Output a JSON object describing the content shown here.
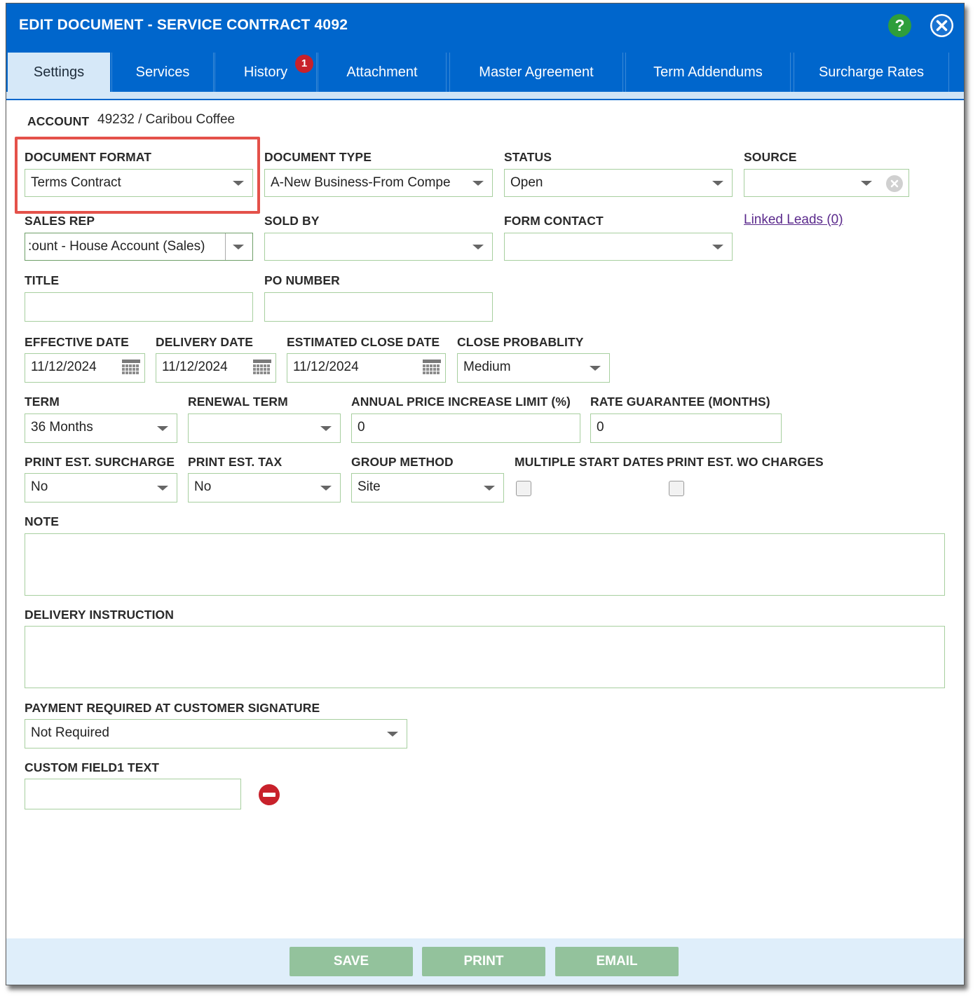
{
  "window": {
    "title": "EDIT DOCUMENT - SERVICE CONTRACT 4092"
  },
  "tabs": [
    {
      "label": "Settings"
    },
    {
      "label": "Services"
    },
    {
      "label": "History",
      "badge": "1"
    },
    {
      "label": "Attachment"
    },
    {
      "label": "Master Agreement"
    },
    {
      "label": "Term Addendums"
    },
    {
      "label": "Surcharge Rates"
    }
  ],
  "account": {
    "label": "ACCOUNT",
    "value": "49232 / Caribou Coffee"
  },
  "fields": {
    "document_format": {
      "label": "DOCUMENT FORMAT",
      "value": "Terms Contract"
    },
    "document_type": {
      "label": "DOCUMENT TYPE",
      "value": "A-New Business-From Compe"
    },
    "status": {
      "label": "STATUS",
      "value": "Open"
    },
    "source": {
      "label": "SOURCE",
      "value": ""
    },
    "sales_rep": {
      "label": "SALES REP",
      "value": ":ount - House Account (Sales)"
    },
    "sold_by": {
      "label": "SOLD BY",
      "value": ""
    },
    "form_contact": {
      "label": "FORM CONTACT",
      "value": ""
    },
    "linked_leads": {
      "label": "Linked Leads (0)"
    },
    "title": {
      "label": "TITLE",
      "value": ""
    },
    "po_number": {
      "label": "PO NUMBER",
      "value": ""
    },
    "effective_date": {
      "label": "EFFECTIVE DATE",
      "value": "11/12/2024"
    },
    "delivery_date": {
      "label": "DELIVERY DATE",
      "value": "11/12/2024"
    },
    "estimated_close_date": {
      "label": "ESTIMATED CLOSE DATE",
      "value": "11/12/2024"
    },
    "close_probability": {
      "label": "CLOSE PROBABLITY",
      "value": "Medium"
    },
    "term": {
      "label": "TERM",
      "value": "36 Months"
    },
    "renewal_term": {
      "label": "RENEWAL TERM",
      "value": ""
    },
    "annual_price_increase": {
      "label": "ANNUAL PRICE INCREASE LIMIT (%)",
      "value": "0"
    },
    "rate_guarantee": {
      "label": "RATE GUARANTEE (MONTHS)",
      "value": "0"
    },
    "print_est_surcharge": {
      "label": "PRINT EST. SURCHARGE",
      "value": "No"
    },
    "print_est_tax": {
      "label": "PRINT EST. TAX",
      "value": "No"
    },
    "group_method": {
      "label": "GROUP METHOD",
      "value": "Site"
    },
    "multiple_start_dates": {
      "label": "MULTIPLE START DATES",
      "checked": false
    },
    "print_est_wo_charges": {
      "label": "PRINT EST. WO CHARGES",
      "checked": false
    },
    "note": {
      "label": "NOTE",
      "value": ""
    },
    "delivery_instruction": {
      "label": "DELIVERY INSTRUCTION",
      "value": ""
    },
    "payment_required": {
      "label": "PAYMENT REQUIRED AT CUSTOMER SIGNATURE",
      "value": "Not Required"
    },
    "custom_field1": {
      "label": "CUSTOM FIELD1 TEXT",
      "value": ""
    }
  },
  "footer": {
    "save_label": "SAVE",
    "print_label": "PRINT",
    "email_label": "EMAIL"
  },
  "colors": {
    "header": "#0066cc",
    "highlight": "#e4514a",
    "button": "#93c29c",
    "badge": "#c8212b"
  },
  "icons": [
    "help-icon",
    "close-icon",
    "calendar-icon",
    "clear-icon",
    "remove-icon",
    "chevron-down-icon"
  ]
}
